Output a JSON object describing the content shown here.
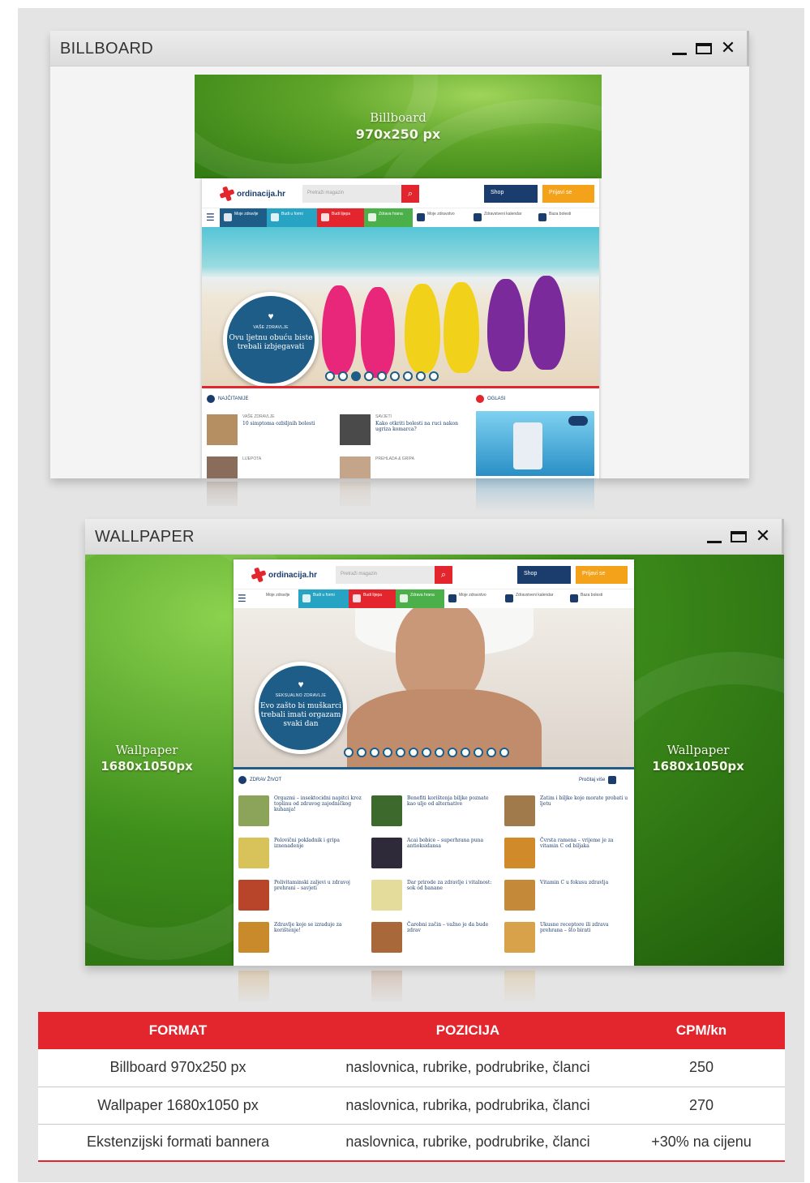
{
  "billboard_window": {
    "title": "BILLBOARD",
    "banner": {
      "line1": "Billboard",
      "line2": "970x250 px"
    },
    "site": {
      "logo": "ordinacija.hr",
      "search_placeholder": "Pretraži magazin",
      "shop_label": "Shop",
      "login_label": "Prijavi se",
      "nav": [
        "Moje zdravlje",
        "Budi u formi",
        "Budi lijepa",
        "Zdrava hrana",
        "Moje zdravstvo",
        "Zdravstveni kalendar",
        "Baza bolesti"
      ],
      "hero": {
        "category": "VAŠE ZDRAVLJE",
        "headline": "Ovu ljetnu obuću biste trebali izbjegavati"
      },
      "section_left": "NAJČITANIJE",
      "section_right": "OGLASI",
      "articles": [
        {
          "category": "VAŠE ZDRAVLJE",
          "title": "10 simptoma ozbiljnih bolesti"
        },
        {
          "category": "SAVJETI",
          "title": "Kako otkriti bolesti na ruci nakon ugriza komarca?"
        },
        {
          "category": "LIJEPOTA",
          "title": ""
        },
        {
          "category": "PREHLADA & GRIPA",
          "title": ""
        }
      ]
    }
  },
  "wallpaper_window": {
    "title": "WALLPAPER",
    "banner_left": {
      "line1": "Wallpaper",
      "line2": "1680x1050px"
    },
    "banner_right": {
      "line1": "Wallpaper",
      "line2": "1680x1050px"
    },
    "site": {
      "logo": "ordinacija.hr",
      "search_placeholder": "Pretraži magazin",
      "shop_label": "Shop",
      "login_label": "Prijavi se",
      "nav": [
        "Moje zdravlje",
        "Budi u formi",
        "Budi lijepa",
        "Zdrava hrana",
        "Moje zdravstvo",
        "Zdravstveni kalendar",
        "Baza bolesti"
      ],
      "hero": {
        "category": "SEKSUALNO ZDRAVLJE",
        "headline": "Evo zašto bi muškarci trebali imati orgazam svaki dan"
      },
      "section_title": "ZDRAV ŽIVOT",
      "section_more": "Pročitaj više",
      "grid": [
        "Orgazmi – insektocidni napitci kroz toplinu od zdravog zajedničkog kuhanja!",
        "Benefiti korištenja biljke poznate kao ulje od alternative",
        "Zatim i biljke koje morate probati u ljetu",
        "Polovični pokladnik i gripa iznenađenje",
        "Acai bobice – superhrana puna antioksidansa",
        "Čvrsta ramena – vrijeme je za vitamin C od biljaka",
        "Polivitaminski zaljevi u zdravoj prehrani – savjeti",
        "Dar prirode za zdravlje i vitalnost: sok od banane",
        "Vitamin C u fokusu zdravlja",
        "Zdravlje koje se izraduje za korištenje!",
        "Čarobni začin – važno je da bude zdrav",
        "Ukusne receptore ili zdrava prehrana – što birati"
      ]
    }
  },
  "pricing_table": {
    "headers": [
      "FORMAT",
      "POZICIJA",
      "CPM/kn"
    ],
    "rows": [
      [
        "Billboard 970x250 px",
        "naslovnica, rubrike, podrubrike, članci",
        "250"
      ],
      [
        "Wallpaper 1680x1050 px",
        "naslovnica, rubrika, podrubrika, članci",
        "270"
      ],
      [
        "Ekstenzijski formati bannera",
        "naslovnica, rubrike, podrubrike, članci",
        "+30% na cijenu"
      ]
    ]
  },
  "colors": {
    "accent_red": "#e3262d",
    "navy": "#1b3d6d",
    "banner_green": "#3f8f1c",
    "nav_colors": [
      "#1e5d88",
      "#27a3c4",
      "#e3262d",
      "#4bb04a",
      "#ffffff",
      "#ffffff",
      "#ffffff"
    ]
  }
}
